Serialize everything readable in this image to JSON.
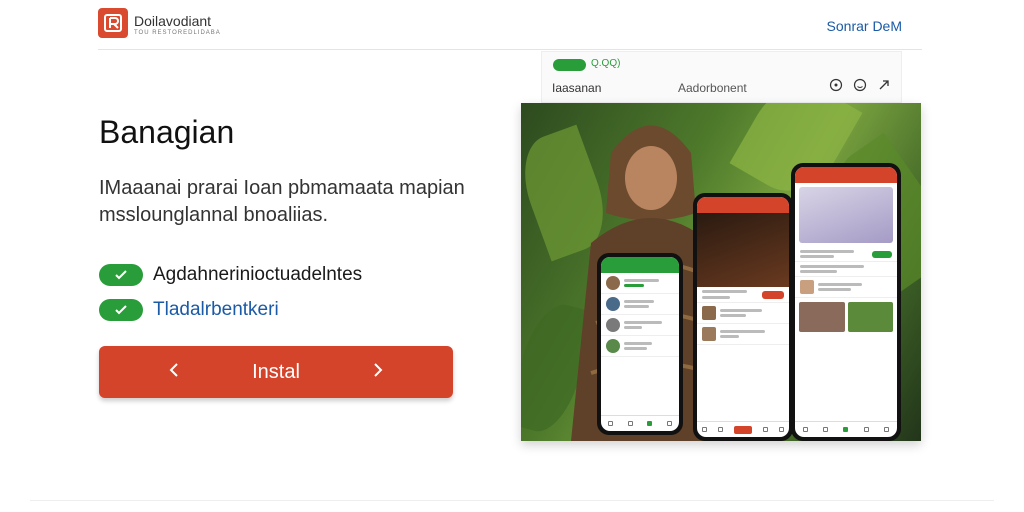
{
  "header": {
    "brand": "Doilavodiant",
    "brand_sub": "TOU RESTOREDLIDABA",
    "demo_link": "Sonrar DeM"
  },
  "hero": {
    "title": "Banagian",
    "description": "IMaaanai prarai Ioan pbmamaata mapian msslounglannal bnoaliias.",
    "features": [
      {
        "label": "Agdahnerinioctuadelntes"
      },
      {
        "label": "Tladalrbentkeri"
      }
    ],
    "cta_label": "Instal"
  },
  "preview": {
    "status_text": "Q.QQ)",
    "left_label": "Iaasanan",
    "mid_label": "Aadorbonent"
  },
  "colors": {
    "accent_red": "#d3442b",
    "accent_green": "#2a9d3b",
    "link_blue": "#1a5aa6"
  },
  "icons": [
    "logo-icon",
    "check-icon",
    "chevron-left-icon",
    "chevron-right-icon",
    "circle-icon",
    "emoji-icon",
    "share-icon"
  ]
}
